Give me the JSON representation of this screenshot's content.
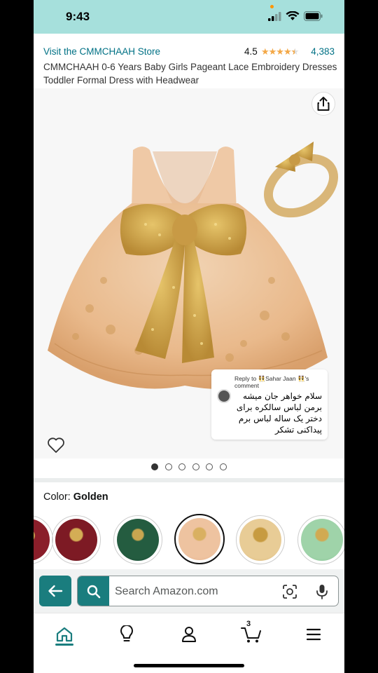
{
  "status": {
    "time": "9:43"
  },
  "header": {
    "store_link": "Visit the CMMCHAAH Store",
    "rating_value": "4.5",
    "rating_stars": 4.5,
    "rating_count": "4,383",
    "title": "CMMCHAAH 0-6 Years Baby Girls Pageant Lace Embroidery Dresses Toddler Formal Dress with Headwear"
  },
  "gallery": {
    "dot_count": 6,
    "active_dot": 0
  },
  "reply": {
    "header": "Reply to 👯Sahar Jaan 👯's comment",
    "text": "سلام خواهر جان میشه برمن لباس سالکره برای دختر یک ساله لباس برم پیداکنی تشکر"
  },
  "color": {
    "label": "Color:",
    "selected": "Golden"
  },
  "search": {
    "placeholder": "Search Amazon.com"
  },
  "nav": {
    "cart_count": "3"
  },
  "colors": {
    "accent": "#1a7d7e",
    "link": "#007185",
    "star": "#f3a847",
    "status_bar": "#a6e0dc"
  }
}
